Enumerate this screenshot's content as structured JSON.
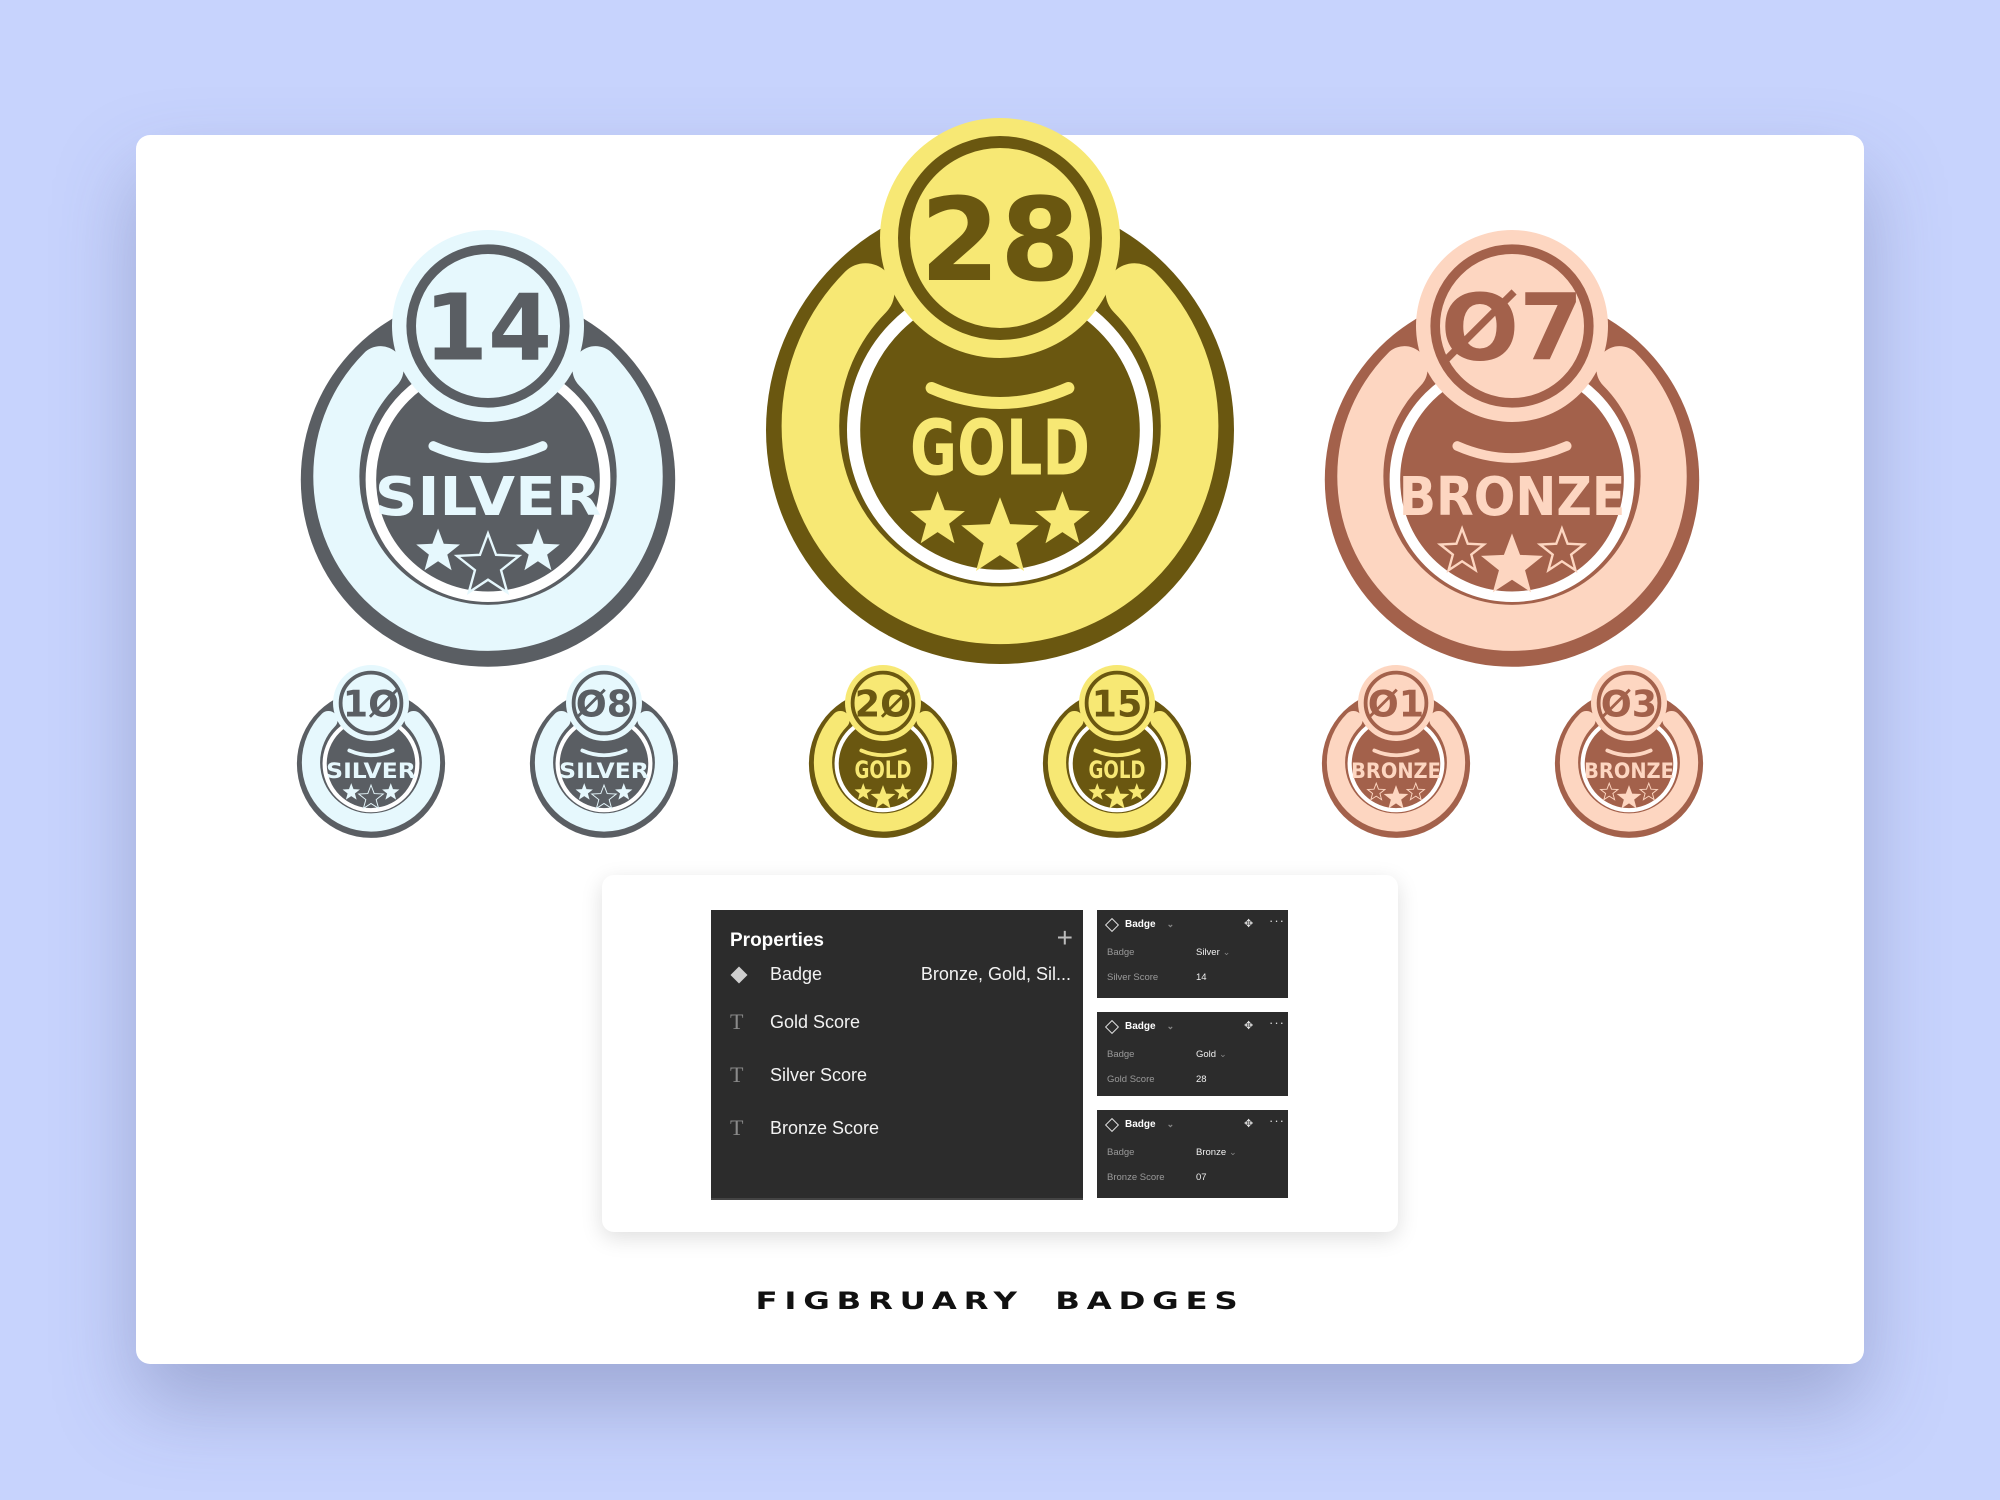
{
  "colors": {
    "background": "#c7d3fd",
    "card": "#ffffff",
    "silver": {
      "dark": "#5a5e63",
      "light": "#e6f8fd"
    },
    "gold": {
      "dark": "#6a5710",
      "light": "#f7e874"
    },
    "bronze": {
      "dark": "#a3614b",
      "light": "#fdd6c1"
    },
    "panel": "#2c2c2c"
  },
  "badges": {
    "large": [
      {
        "tier": "silver",
        "label": "SILVER",
        "score": "14",
        "stars": [
          "filled",
          "outline",
          "filled"
        ]
      },
      {
        "tier": "gold",
        "label": "GOLD",
        "score": "28",
        "stars": [
          "filled",
          "filled",
          "filled"
        ]
      },
      {
        "tier": "bronze",
        "label": "BRONZE",
        "score": "07",
        "stars": [
          "outline",
          "filled",
          "outline"
        ]
      }
    ],
    "small": [
      {
        "tier": "silver",
        "label": "SILVER",
        "score": "10",
        "stars": [
          "filled",
          "outline",
          "filled"
        ]
      },
      {
        "tier": "silver",
        "label": "SILVER",
        "score": "08",
        "stars": [
          "filled",
          "outline",
          "filled"
        ]
      },
      {
        "tier": "gold",
        "label": "GOLD",
        "score": "20",
        "stars": [
          "filled",
          "filled",
          "filled"
        ]
      },
      {
        "tier": "gold",
        "label": "GOLD",
        "score": "15",
        "stars": [
          "filled",
          "filled",
          "filled"
        ]
      },
      {
        "tier": "bronze",
        "label": "BRONZE",
        "score": "01",
        "stars": [
          "outline",
          "filled",
          "outline"
        ]
      },
      {
        "tier": "bronze",
        "label": "BRONZE",
        "score": "03",
        "stars": [
          "outline",
          "filled",
          "outline"
        ]
      }
    ]
  },
  "properties_panel": {
    "title": "Properties",
    "add_icon": "plus-icon",
    "rows": [
      {
        "icon": "variant-diamond-icon",
        "label": "Badge",
        "value": "Bronze, Gold, Sil..."
      },
      {
        "icon": "text-icon",
        "label": "Gold Score",
        "value": ""
      },
      {
        "icon": "text-icon",
        "label": "Silver Score",
        "value": ""
      },
      {
        "icon": "text-icon",
        "label": "Bronze Score",
        "value": ""
      }
    ]
  },
  "instance_panels": [
    {
      "name": "Badge",
      "variant_label": "Badge",
      "variant_value": "Silver",
      "score_label": "Silver Score",
      "score_value": "14"
    },
    {
      "name": "Badge",
      "variant_label": "Badge",
      "variant_value": "Gold",
      "score_label": "Gold Score",
      "score_value": "28"
    },
    {
      "name": "Badge",
      "variant_label": "Badge",
      "variant_value": "Bronze",
      "score_label": "Bronze Score",
      "score_value": "07"
    }
  ],
  "footer": {
    "title": "FIGBRUARY  BADGES"
  }
}
